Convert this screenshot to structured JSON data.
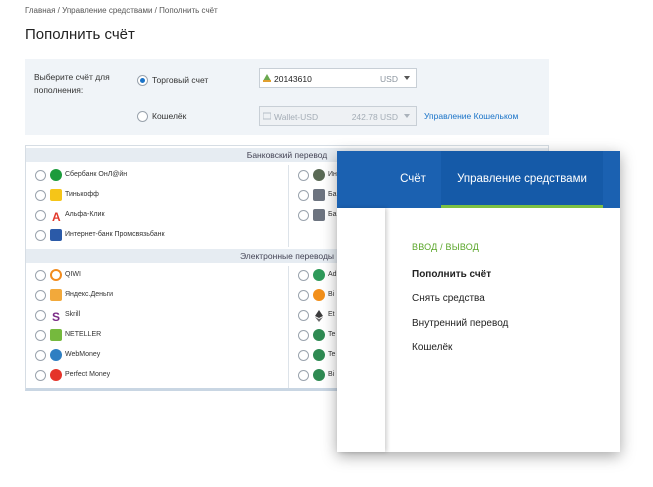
{
  "breadcrumb": "Главная / Управление средствами / Пополнить счёт",
  "page_title": "Пополнить счёт",
  "form": {
    "label": "Выберите счёт для пополнения:",
    "option_trading": "Торговый счет",
    "option_wallet": "Кошелёк",
    "account_value": "20143610",
    "account_currency": "USD",
    "wallet_value": "Wallet-USD",
    "wallet_amount": "242.78 USD",
    "wallet_link": "Управление Кошельком"
  },
  "bank_section": {
    "title": "Банковский перевод",
    "left": [
      {
        "name": "Сбербанк ОнЛ@йн",
        "color": "#1c9b3b"
      },
      {
        "name": "Тинькофф",
        "color": "#f5c518"
      },
      {
        "name": "Альфа-Клик",
        "color": "#e23a2c"
      },
      {
        "name": "Интернет-банк Промсвязьбанк",
        "color": "#2b5aa8"
      }
    ],
    "right": [
      {
        "name": "Ин",
        "color": "#5a6a55"
      },
      {
        "name": "Бан",
        "color": "#6d7480"
      },
      {
        "name": "Бан",
        "color": "#6d7480"
      }
    ]
  },
  "electronic_section": {
    "title": "Электронные переводы",
    "left": [
      {
        "name": "QIWI",
        "color": "#f28c1e"
      },
      {
        "name": "Яндекс.Деньги",
        "color": "#f2a93b"
      },
      {
        "name": "Skrill",
        "color": "#7a2a86"
      },
      {
        "name": "NETELLER",
        "color": "#75b93d"
      },
      {
        "name": "WebMoney",
        "color": "#2f7fc2"
      },
      {
        "name": "Perfect Money",
        "color": "#e5342a"
      }
    ],
    "right": [
      {
        "name": "Ad",
        "color": "#2f9a5a"
      },
      {
        "name": "Bi",
        "color": "#f28f1a"
      },
      {
        "name": "Et",
        "color": "#3c3c3d"
      },
      {
        "name": "Te",
        "color": "#2e8a52"
      },
      {
        "name": "Te",
        "color": "#2e8a52"
      },
      {
        "name": "Bi",
        "color": "#2e8a52"
      }
    ]
  },
  "overlay": {
    "tab_account": "Счёт",
    "tab_funds": "Управление средствами",
    "menu_head": "ВВОД / ВЫВОД",
    "items": [
      "Пополнить счёт",
      "Снять средства",
      "Внутренний перевод",
      "Кошелёк"
    ]
  },
  "colors": {
    "brand_blue": "#1b61b1",
    "accent_green": "#7cc043",
    "link_blue": "#1a73c8"
  }
}
